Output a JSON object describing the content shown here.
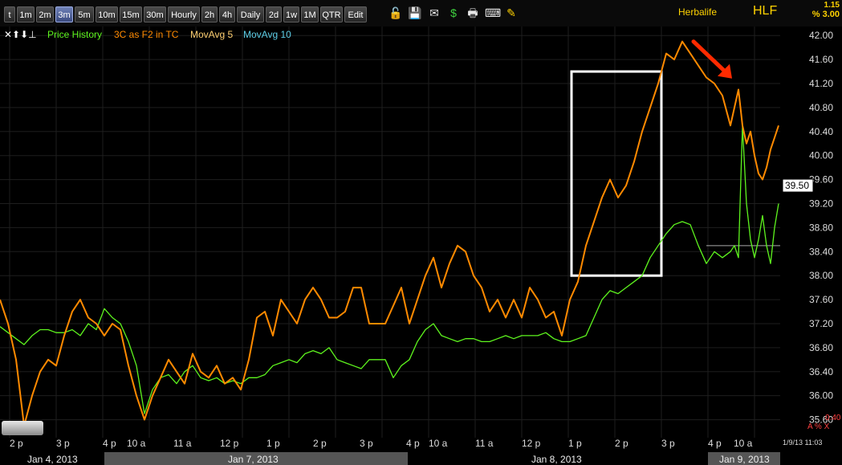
{
  "toolbar": {
    "timeframes": [
      "t",
      "1m",
      "2m",
      "3m",
      "5m",
      "10m",
      "15m",
      "30m",
      "Hourly",
      "2h",
      "4h",
      "Daily",
      "2d",
      "1w",
      "1M",
      "QTR",
      "Edit"
    ],
    "active": "3m",
    "icons": [
      "lock-icon",
      "save-icon",
      "email-icon",
      "dollar-icon",
      "print-icon",
      "keyboard-icon",
      "pencil-icon"
    ]
  },
  "ticker": {
    "name": "Herbalife",
    "symbol": "HLF",
    "change": "1.15",
    "change_pct": "% 3.00"
  },
  "legend": [
    "Price History",
    "3C as F2 in TC",
    "MovAvg 5",
    "MovAvg 10"
  ],
  "colors": {
    "price": "#5ef51e",
    "indicator": "#ff8a00",
    "ma5": "#ffd070",
    "ma10": "#5ecfe8",
    "box": "#ffffff",
    "arrow": "#ff2a00"
  },
  "current_price": "39.50",
  "bottom_right": {
    "value": "0.40",
    "controls": "A % X"
  },
  "timestamp": "1/9/13 11:03",
  "x_axis_labels": [
    "2 p",
    "3 p",
    "4 p",
    "10 a",
    "11 a",
    "12 p",
    "1 p",
    "2 p",
    "3 p",
    "4 p",
    "10 a",
    "11 a",
    "12 p",
    "1 p",
    "2 p",
    "3 p",
    "4 p",
    "10 a"
  ],
  "dates": [
    "Jan 4, 2013",
    "Jan 7, 2013",
    "Jan 8, 2013",
    "Jan 9, 2013"
  ],
  "chart_data": {
    "type": "line",
    "title": "",
    "xlabel": "",
    "ylabel": "",
    "ylim": [
      35.3,
      42.15
    ],
    "y_ticks": [
      "42.00",
      "41.60",
      "41.20",
      "40.80",
      "40.40",
      "40.00",
      "39.60",
      "39.20",
      "38.80",
      "38.40",
      "38.00",
      "37.60",
      "37.20",
      "36.80",
      "36.40",
      "36.00",
      "35.60"
    ],
    "y_tick_values": [
      42.0,
      41.6,
      41.2,
      40.8,
      40.4,
      40.0,
      39.6,
      39.2,
      38.8,
      38.4,
      38.0,
      37.6,
      37.2,
      36.8,
      36.4,
      36.0,
      35.6
    ],
    "x_index": "sequential 3-minute bars, Jan 4 2013 2 p through Jan 9 2013 ~11:03 a",
    "series": [
      {
        "name": "Price History",
        "x": [
          0,
          10,
          20,
          30,
          40,
          50,
          60,
          70,
          80,
          90,
          100,
          110,
          120,
          130,
          140,
          150,
          160,
          170,
          180,
          190,
          200,
          210,
          220,
          230,
          240,
          250,
          260,
          270,
          280,
          290,
          300,
          310,
          320,
          330,
          340,
          350,
          360,
          370,
          380,
          390,
          400,
          410,
          420,
          430,
          440,
          450,
          460,
          470,
          480,
          490,
          500,
          510,
          520,
          530,
          540,
          550,
          560,
          570,
          580,
          590,
          600,
          610,
          620,
          630,
          640,
          650,
          660,
          670,
          680,
          690,
          700,
          710,
          720,
          730,
          740,
          750,
          760,
          770,
          780,
          790,
          800,
          810,
          820,
          830,
          840,
          850,
          860,
          870,
          880,
          890,
          900,
          910,
          915,
          920,
          925,
          930,
          935,
          940,
          945,
          950,
          955,
          960,
          965,
          970
        ],
        "y": [
          37.15,
          37.05,
          36.95,
          36.85,
          37.0,
          37.1,
          37.1,
          37.05,
          37.05,
          37.1,
          37.0,
          37.2,
          37.1,
          37.45,
          37.3,
          37.2,
          36.9,
          36.5,
          35.7,
          36.1,
          36.3,
          36.35,
          36.2,
          36.4,
          36.5,
          36.3,
          36.25,
          36.3,
          36.2,
          36.25,
          36.2,
          36.3,
          36.3,
          36.35,
          36.5,
          36.55,
          36.6,
          36.55,
          36.7,
          36.75,
          36.7,
          36.8,
          36.6,
          36.55,
          36.5,
          36.45,
          36.6,
          36.6,
          36.6,
          36.3,
          36.5,
          36.6,
          36.9,
          37.1,
          37.2,
          37.0,
          36.95,
          36.9,
          36.95,
          36.95,
          36.9,
          36.9,
          36.95,
          37.0,
          36.95,
          37.0,
          37.0,
          37.0,
          37.05,
          36.95,
          36.9,
          36.9,
          36.95,
          37.0,
          37.3,
          37.6,
          37.75,
          37.7,
          37.8,
          37.9,
          38.0,
          38.3,
          38.5,
          38.7,
          38.85,
          38.9,
          38.85,
          38.5,
          38.2,
          38.4,
          38.3,
          38.4,
          38.5,
          38.3,
          40.5,
          39.2,
          38.6,
          38.3,
          38.6,
          39.0,
          38.5,
          38.2,
          38.8,
          39.2
        ]
      },
      {
        "name": "3C as F2 in TC",
        "x": [
          0,
          10,
          20,
          30,
          40,
          50,
          60,
          70,
          80,
          90,
          100,
          110,
          120,
          130,
          140,
          150,
          160,
          170,
          180,
          190,
          200,
          210,
          220,
          230,
          240,
          250,
          260,
          270,
          280,
          290,
          300,
          310,
          320,
          330,
          340,
          350,
          360,
          370,
          380,
          390,
          400,
          410,
          420,
          430,
          440,
          450,
          460,
          470,
          480,
          490,
          500,
          510,
          520,
          530,
          540,
          550,
          560,
          570,
          580,
          590,
          600,
          610,
          620,
          630,
          640,
          650,
          660,
          670,
          680,
          690,
          700,
          710,
          720,
          730,
          740,
          750,
          760,
          770,
          780,
          790,
          800,
          810,
          820,
          830,
          840,
          850,
          860,
          870,
          880,
          890,
          900,
          910,
          915,
          920,
          925,
          930,
          935,
          940,
          945,
          950,
          955,
          960,
          965,
          970
        ],
        "y": [
          37.6,
          37.2,
          36.6,
          35.5,
          36.0,
          36.4,
          36.6,
          36.5,
          37.0,
          37.4,
          37.6,
          37.3,
          37.2,
          37.0,
          37.2,
          37.1,
          36.5,
          36.0,
          35.6,
          36.0,
          36.3,
          36.6,
          36.4,
          36.2,
          36.7,
          36.4,
          36.3,
          36.5,
          36.2,
          36.3,
          36.1,
          36.6,
          37.3,
          37.4,
          37.0,
          37.6,
          37.4,
          37.2,
          37.6,
          37.8,
          37.6,
          37.3,
          37.3,
          37.4,
          37.8,
          37.8,
          37.2,
          37.2,
          37.2,
          37.5,
          37.8,
          37.2,
          37.6,
          38.0,
          38.3,
          37.8,
          38.2,
          38.5,
          38.4,
          38.0,
          37.8,
          37.4,
          37.6,
          37.3,
          37.6,
          37.3,
          37.8,
          37.6,
          37.3,
          37.4,
          37.0,
          37.6,
          37.9,
          38.5,
          38.9,
          39.3,
          39.6,
          39.3,
          39.5,
          39.9,
          40.4,
          40.8,
          41.2,
          41.7,
          41.6,
          41.9,
          41.7,
          41.5,
          41.3,
          41.2,
          41.0,
          40.5,
          40.8,
          41.1,
          40.5,
          40.2,
          40.4,
          40.0,
          39.7,
          39.6,
          39.8,
          40.1,
          40.3,
          40.5
        ]
      }
    ],
    "annotations": [
      {
        "type": "box",
        "x_range": [
          710,
          820
        ],
        "y_range": [
          38.0,
          41.4
        ]
      },
      {
        "type": "arrow",
        "target_x": 915,
        "target_y": 41.15
      },
      {
        "type": "hline",
        "y": 38.5
      }
    ]
  }
}
